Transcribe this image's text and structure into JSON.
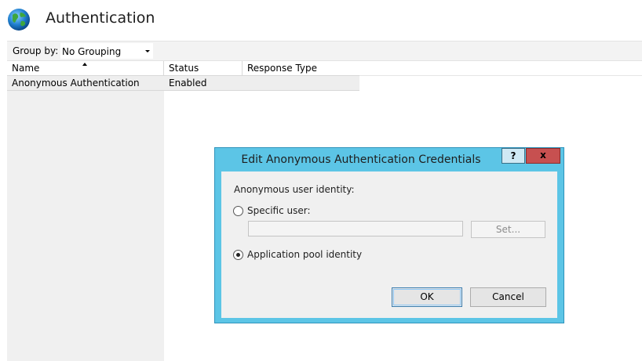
{
  "header": {
    "title": "Authentication",
    "icon": "globe-icon"
  },
  "toolbar": {
    "group_by_label": "Group by:",
    "group_by_value": "No Grouping"
  },
  "table": {
    "columns": [
      "Name",
      "Status",
      "Response Type"
    ],
    "rows": [
      {
        "name": "Anonymous Authentication",
        "status": "Enabled",
        "response_type": ""
      }
    ]
  },
  "dialog": {
    "title": "Edit Anonymous Authentication Credentials",
    "help_label": "?",
    "close_label": "x",
    "identity_label": "Anonymous user identity:",
    "specific_user_label": "Specific user:",
    "specific_user_value": "",
    "set_label": "Set...",
    "app_pool_label": "Application pool identity",
    "selected_option": "app_pool",
    "ok_label": "OK",
    "cancel_label": "Cancel"
  },
  "colors": {
    "dialog_frame": "#5cc5e6",
    "close_button": "#c75050",
    "row_selected": "#eeeeee"
  }
}
